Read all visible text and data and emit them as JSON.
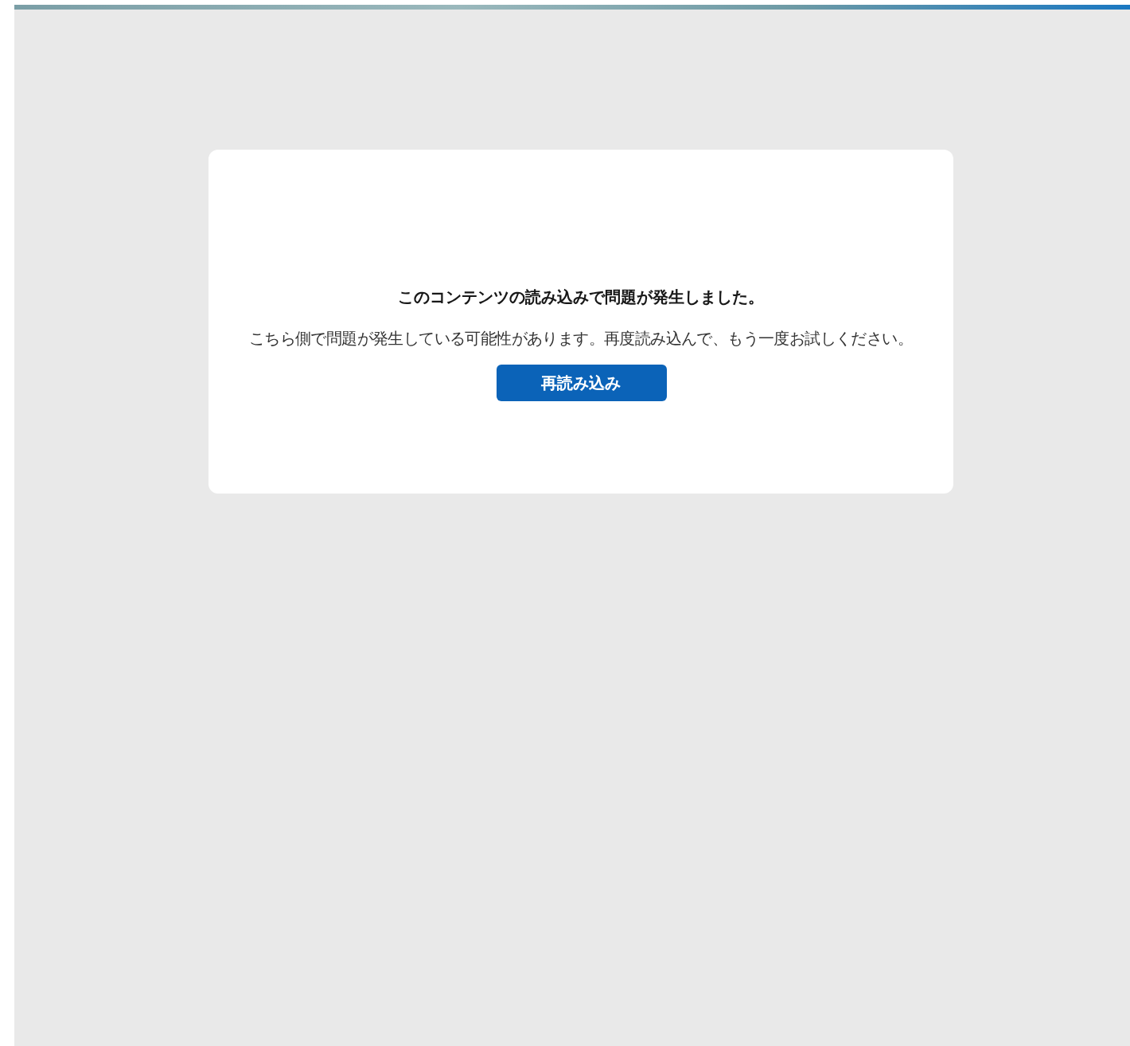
{
  "error_card": {
    "title": "このコンテンツの読み込みで問題が発生しました。",
    "message": "こちら側で問題が発生している可能性があります。再度読み込んで、もう一度お試しください。",
    "button": "再読み込み"
  }
}
